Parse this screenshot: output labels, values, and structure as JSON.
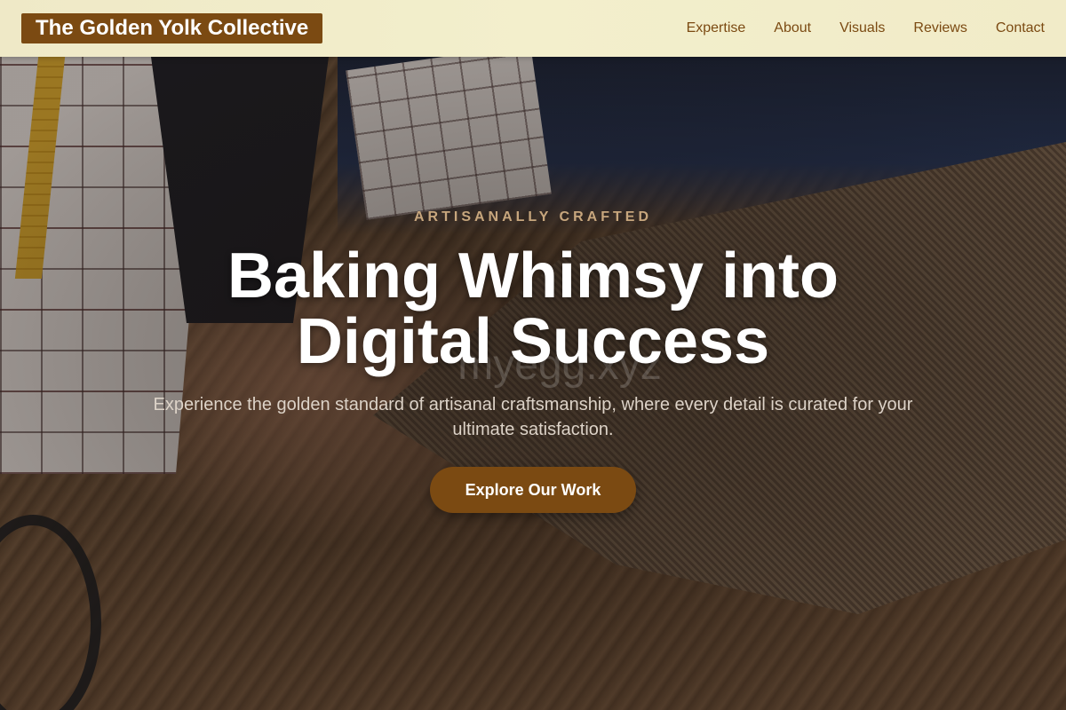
{
  "header": {
    "logo": "The Golden Yolk Collective",
    "nav": [
      {
        "label": "Expertise"
      },
      {
        "label": "About"
      },
      {
        "label": "Visuals"
      },
      {
        "label": "Reviews"
      },
      {
        "label": "Contact"
      }
    ]
  },
  "hero": {
    "eyebrow": "ARTISANALLY CRAFTED",
    "headline": "Baking Whimsy into Digital Success",
    "watermark": "myegg.xyz",
    "subtext": "Experience the golden standard of artisanal craftsmanship, where every detail is curated for your ultimate satisfaction.",
    "cta_label": "Explore Our Work"
  },
  "colors": {
    "brand": "#7b4a12",
    "header_bg": "#f3efcc",
    "eyebrow": "#c7a67d"
  }
}
